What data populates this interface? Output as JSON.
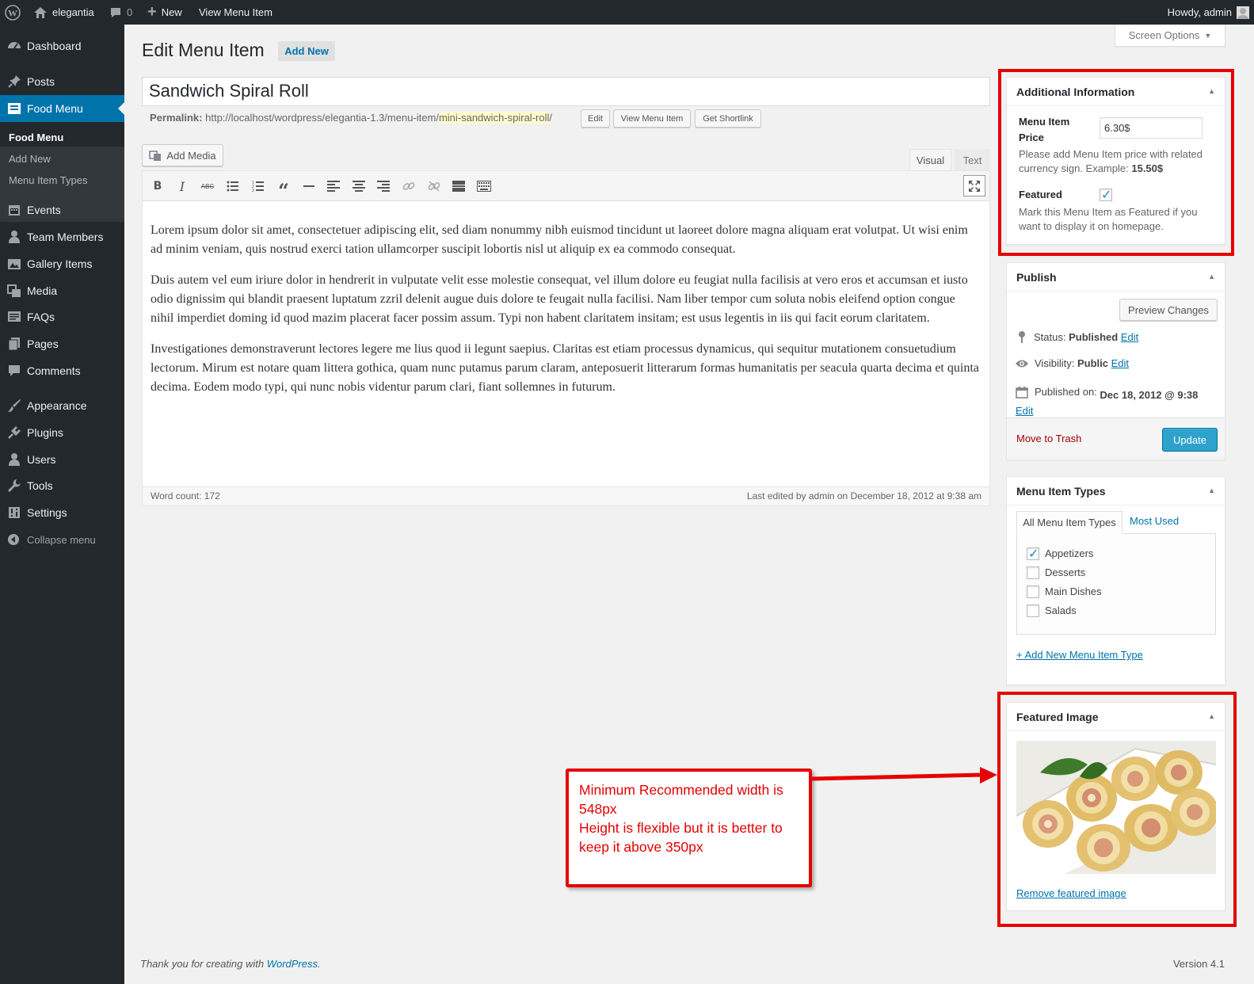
{
  "adminbar": {
    "site_name": "elegantia",
    "comments_count": "0",
    "new_label": "New",
    "view_label": "View Menu Item",
    "howdy": "Howdy, admin"
  },
  "sidebar": {
    "items": [
      {
        "label": "Dashboard",
        "icon": "dashboard-icon"
      },
      {
        "label": "Posts",
        "icon": "pin-icon"
      },
      {
        "label": "Food Menu",
        "icon": "food-menu-icon"
      },
      {
        "label": "Events",
        "icon": "calendar-icon"
      },
      {
        "label": "Team Members",
        "icon": "person-icon"
      },
      {
        "label": "Gallery Items",
        "icon": "gallery-icon"
      },
      {
        "label": "Media",
        "icon": "media-icon"
      },
      {
        "label": "FAQs",
        "icon": "faq-icon"
      },
      {
        "label": "Pages",
        "icon": "pages-icon"
      },
      {
        "label": "Comments",
        "icon": "comment-icon"
      },
      {
        "label": "Appearance",
        "icon": "brush-icon"
      },
      {
        "label": "Plugins",
        "icon": "plugin-icon"
      },
      {
        "label": "Users",
        "icon": "users-icon"
      },
      {
        "label": "Tools",
        "icon": "wrench-icon"
      },
      {
        "label": "Settings",
        "icon": "settings-icon"
      }
    ],
    "submenu": [
      "Food Menu",
      "Add New",
      "Menu Item Types"
    ],
    "collapse": "Collapse menu"
  },
  "screen_options": "Screen Options",
  "heading": {
    "title": "Edit Menu Item",
    "add_new": "Add New"
  },
  "post_title": "Sandwich Spiral Roll",
  "permalink": {
    "label": "Permalink:",
    "base": "http://localhost/wordpress/elegantia-1.3/menu-item/",
    "slug": "mini-sandwich-spiral-roll",
    "end": "/",
    "edit": "Edit",
    "view": "View Menu Item",
    "shortlink": "Get Shortlink"
  },
  "editor": {
    "add_media": "Add Media",
    "tab_visual": "Visual",
    "tab_text": "Text",
    "paragraphs": [
      "Lorem ipsum dolor sit amet, consectetuer adipiscing elit, sed diam nonummy nibh euismod tincidunt ut laoreet dolore magna aliquam erat volutpat. Ut wisi enim ad minim veniam, quis nostrud exerci tation ullamcorper suscipit lobortis nisl ut aliquip ex ea commodo consequat.",
      "Duis autem vel eum iriure dolor in hendrerit in vulputate velit esse molestie consequat, vel illum dolore eu feugiat nulla facilisis at vero eros et accumsan et iusto odio dignissim qui blandit praesent luptatum zzril delenit augue duis dolore te feugait nulla facilisi. Nam liber tempor cum soluta nobis eleifend option congue nihil imperdiet doming id quod mazim placerat facer possim assum. Typi non habent claritatem insitam; est usus legentis in iis qui facit eorum claritatem.",
      "Investigationes demonstraverunt lectores legere me lius quod ii legunt saepius. Claritas est etiam processus dynamicus, qui sequitur mutationem consuetudium lectorum. Mirum est notare quam littera gothica, quam nunc putamus parum claram, anteposuerit litterarum formas humanitatis per seacula quarta decima et quinta decima. Eodem modo typi, qui nunc nobis videntur parum clari, fiant sollemnes in futurum."
    ],
    "word_count": "Word count: 172",
    "last_edited": "Last edited by admin on December 18, 2012 at 9:38 am"
  },
  "additional_info": {
    "title": "Additional Information",
    "price_label": "Menu Item Price",
    "price_value": "6.30$",
    "price_help": "Please add Menu Item price with related currency sign. Example:",
    "price_example": "15.50$",
    "featured_label": "Featured",
    "featured_checked": true,
    "featured_help": "Mark this Menu Item as Featured if you want to display it on homepage."
  },
  "publish": {
    "title": "Publish",
    "preview": "Preview Changes",
    "status_label": "Status:",
    "status_value": "Published",
    "visibility_label": "Visibility:",
    "visibility_value": "Public",
    "published_label": "Published on:",
    "published_value": "Dec 18, 2012 @ 9:38",
    "edit": "Edit",
    "trash": "Move to Trash",
    "update": "Update"
  },
  "types": {
    "title": "Menu Item Types",
    "tab_all": "All Menu Item Types",
    "tab_most": "Most Used",
    "items": [
      {
        "label": "Appetizers",
        "checked": true
      },
      {
        "label": "Desserts",
        "checked": false
      },
      {
        "label": "Main Dishes",
        "checked": false
      },
      {
        "label": "Salads",
        "checked": false
      }
    ],
    "add_new": "+ Add New Menu Item Type"
  },
  "featured_image": {
    "title": "Featured Image",
    "remove": "Remove featured image"
  },
  "annotation": {
    "line1": "Minimum Recommended width is 548px",
    "line2": "Height is flexible but it is better to keep it above 350px",
    "color": "#e60000"
  },
  "footer": {
    "thanks": "Thank you for creating with",
    "wp_link": "WordPress",
    "period": ".",
    "version": "Version 4.1"
  },
  "colors": {
    "accent": "#0073aa",
    "sidebar": "#23282d",
    "update_button": "#2ea2cc",
    "annotation": "#e60000"
  }
}
